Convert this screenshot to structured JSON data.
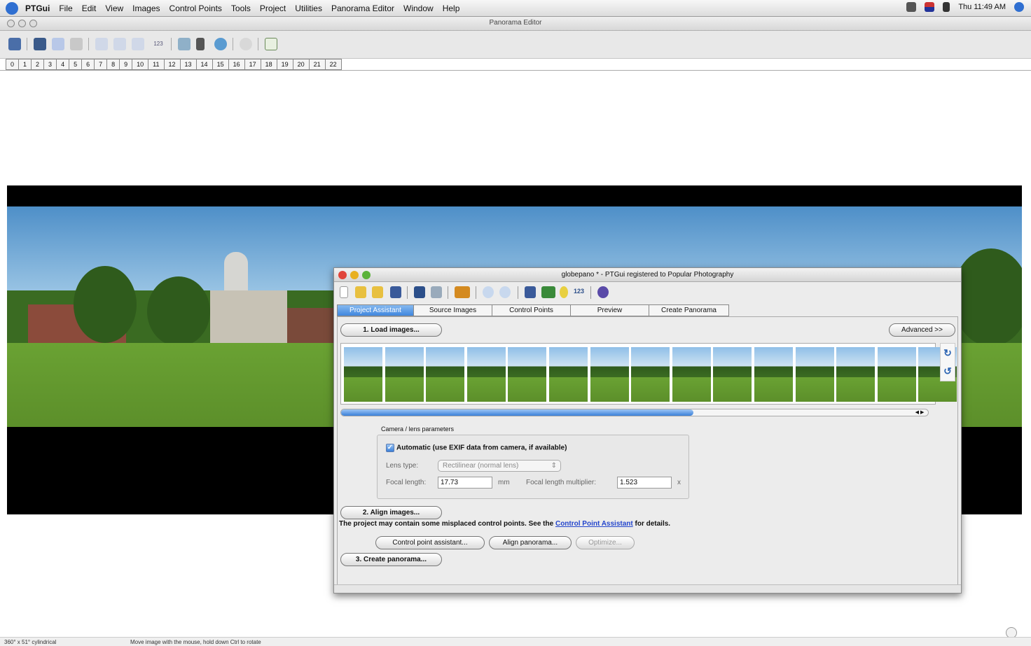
{
  "menubar": {
    "app": "PTGui",
    "items": [
      "File",
      "Edit",
      "View",
      "Images",
      "Control Points",
      "Tools",
      "Project",
      "Utilities",
      "Panorama Editor",
      "Window",
      "Help"
    ],
    "clock": "Thu 11:49 AM"
  },
  "editor": {
    "title": "Panorama Editor",
    "image_tabs": [
      "0",
      "1",
      "2",
      "3",
      "4",
      "5",
      "6",
      "7",
      "8",
      "9",
      "10",
      "11",
      "12",
      "13",
      "14",
      "15",
      "16",
      "17",
      "18",
      "19",
      "20",
      "21",
      "22"
    ],
    "toolbar_text": "123"
  },
  "ptgui": {
    "title": "globepano * - PTGui registered to Popular Photography",
    "toolbar_text": "123",
    "tabs": [
      "Project Assistant",
      "Source Images",
      "Control Points",
      "Preview",
      "Create Panorama"
    ],
    "load_images_button": "1. Load images...",
    "advanced_button": "Advanced >>",
    "thumbnail_count": 15,
    "thumbnail_scroll_position": 0.6,
    "camera": {
      "group_label": "Camera / lens parameters",
      "automatic_label": "Automatic (use EXIF data from camera, if available)",
      "automatic_checked": true,
      "lens_type_label": "Lens type:",
      "lens_type_value": "Rectilinear (normal lens)",
      "focal_length_label": "Focal length:",
      "focal_length_value": "17.73",
      "focal_unit": "mm",
      "multiplier_label": "Focal length multiplier:",
      "multiplier_value": "1.523",
      "multiplier_unit": "x"
    },
    "align_button": "2. Align images...",
    "message_before": "The project may contain some misplaced control points. See the",
    "message_link": "Control Point Assistant",
    "message_after": "for details.",
    "cp_assistant_button": "Control point assistant...",
    "align_panorama_button": "Align panorama...",
    "optimize_button": "Optimize...",
    "create_button": "3. Create panorama..."
  },
  "statusbar": {
    "left": "360° x 51° cylindrical",
    "hint": "Move image with the mouse, hold down Ctrl to rotate"
  },
  "colors": {
    "accent_blue": "#3a7fd8",
    "link_blue": "#2244cc",
    "close_red": "#e0443a",
    "minimize_yellow": "#e8b020",
    "zoom_green": "#5bb33a"
  }
}
